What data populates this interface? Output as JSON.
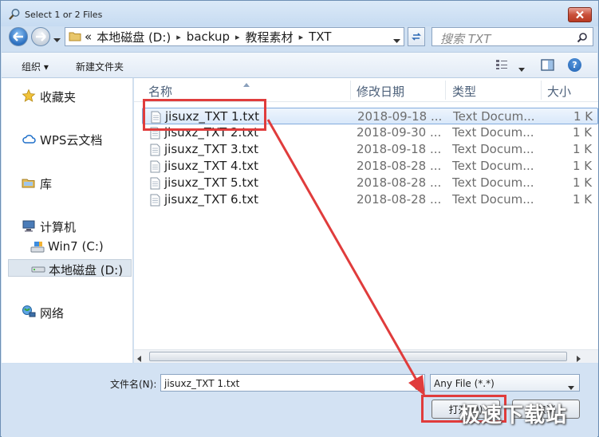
{
  "window": {
    "title": "Select 1 or 2 Files"
  },
  "address": {
    "overflow": "«",
    "crumbs": [
      "本地磁盘 (D:)",
      "backup",
      "教程素材",
      "TXT"
    ],
    "search_placeholder": "搜索 TXT"
  },
  "toolbar": {
    "organize": "组织 ▾",
    "new_folder": "新建文件夹",
    "help": "?"
  },
  "sidebar": {
    "items": [
      {
        "label": "收藏夹",
        "icon": "star-icon"
      },
      {
        "label": "WPS云文档",
        "icon": "cloud-icon"
      },
      {
        "label": "库",
        "icon": "library-icon"
      },
      {
        "label": "计算机",
        "icon": "computer-icon"
      },
      {
        "label": "Win7 (C:)",
        "icon": "drive-icon"
      },
      {
        "label": "本地磁盘 (D:)",
        "icon": "drive-icon"
      },
      {
        "label": "网络",
        "icon": "network-icon"
      }
    ]
  },
  "columns": {
    "name": "名称",
    "date": "修改日期",
    "type": "类型",
    "size": "大小"
  },
  "files": [
    {
      "name": "jisuxz_TXT 1.txt",
      "date": "2018-09-18 ...",
      "type": "Text Docum...",
      "size": "1 K"
    },
    {
      "name": "jisuxz_TXT 2.txt",
      "date": "2018-09-30 ...",
      "type": "Text Docum...",
      "size": "1 K"
    },
    {
      "name": "jisuxz_TXT 3.txt",
      "date": "2018-09-18 ...",
      "type": "Text Docum...",
      "size": "1 K"
    },
    {
      "name": "jisuxz_TXT 4.txt",
      "date": "2018-08-28 ...",
      "type": "Text Docum...",
      "size": "1 K"
    },
    {
      "name": "jisuxz_TXT 5.txt",
      "date": "2018-08-28 ...",
      "type": "Text Docum...",
      "size": "1 K"
    },
    {
      "name": "jisuxz_TXT 6.txt",
      "date": "2018-08-28 ...",
      "type": "Text Docum...",
      "size": "1 K"
    }
  ],
  "bottom": {
    "filename_label": "文件名(N):",
    "filename_value": "jisuxz_TXT 1.txt",
    "filetype_value": "Any File (*.*)",
    "open_label": "打开(O)",
    "cancel_label": "取消"
  },
  "overlay": {
    "watermark": "极速下载站",
    "accent_color": "#e03c3c"
  }
}
